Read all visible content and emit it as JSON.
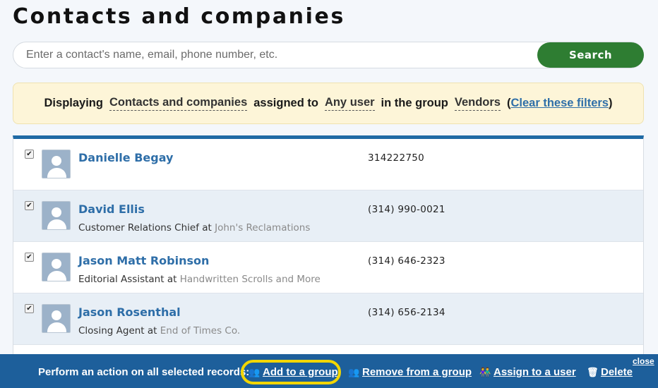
{
  "page": {
    "title": "Contacts and companies"
  },
  "search": {
    "placeholder": "Enter a contact's name, email, phone number, etc.",
    "value": "",
    "button_label": "Search"
  },
  "filter": {
    "prefix": "Displaying",
    "type": "Contacts and companies",
    "assigned_text": "assigned to",
    "user": "Any user",
    "group_text": "in the group",
    "group": "Vendors",
    "open_paren": "(",
    "clear_label": "Clear these filters",
    "close_paren": ")"
  },
  "contacts": [
    {
      "name": "Danielle Begay",
      "title": "",
      "at": "",
      "company": "",
      "phone": "314222750",
      "checked": true
    },
    {
      "name": "David Ellis",
      "title": "Customer Relations Chief",
      "at": "at",
      "company": "John's Reclamations",
      "phone": "(314) 990-0021",
      "checked": true
    },
    {
      "name": "Jason Matt Robinson",
      "title": "Editorial Assistant",
      "at": "at",
      "company": "Handwritten Scrolls and More",
      "phone": "(314) 646-2323",
      "checked": true
    },
    {
      "name": "Jason Rosenthal",
      "title": "Closing Agent",
      "at": "at",
      "company": "End of Times Co.",
      "phone": "(314) 656-2134",
      "checked": true
    }
  ],
  "action_bar": {
    "label": "Perform an action on all selected records:",
    "add_to_group": "Add to a group",
    "remove_from_group": "Remove from a group",
    "assign_to_user": "Assign to a user",
    "delete": "Delete",
    "close": "close"
  },
  "colors": {
    "accent_blue": "#1d5f9b",
    "search_green": "#2e7d32",
    "highlight": "#f2d600",
    "banner": "#fdf5d8"
  }
}
